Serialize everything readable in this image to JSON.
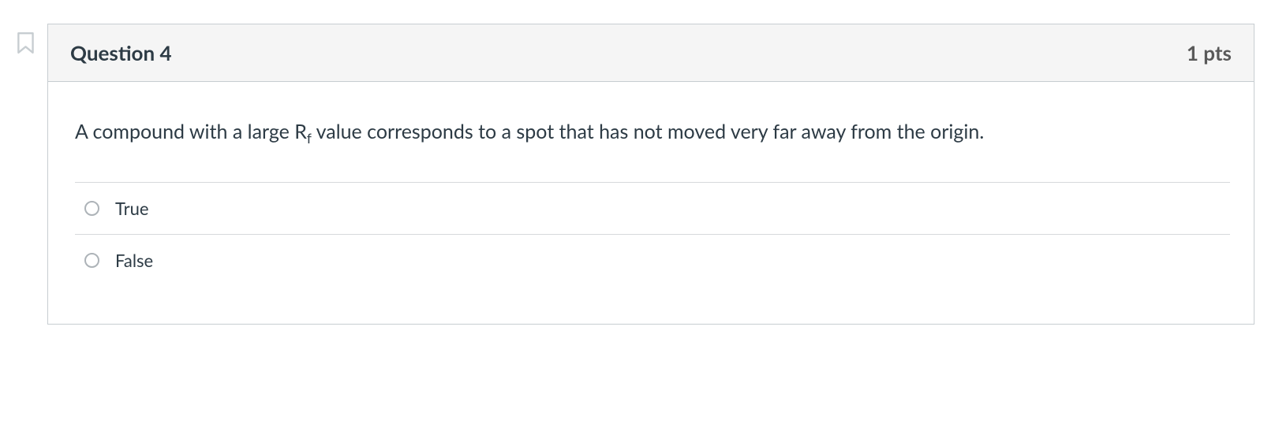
{
  "question": {
    "title": "Question 4",
    "points": "1 pts",
    "text_before_sub": "A compound with a large R",
    "text_sub": "f",
    "text_after_sub": " value corresponds to a spot that has not moved very far away from the origin.",
    "options": [
      {
        "label": "True"
      },
      {
        "label": "False"
      }
    ]
  }
}
